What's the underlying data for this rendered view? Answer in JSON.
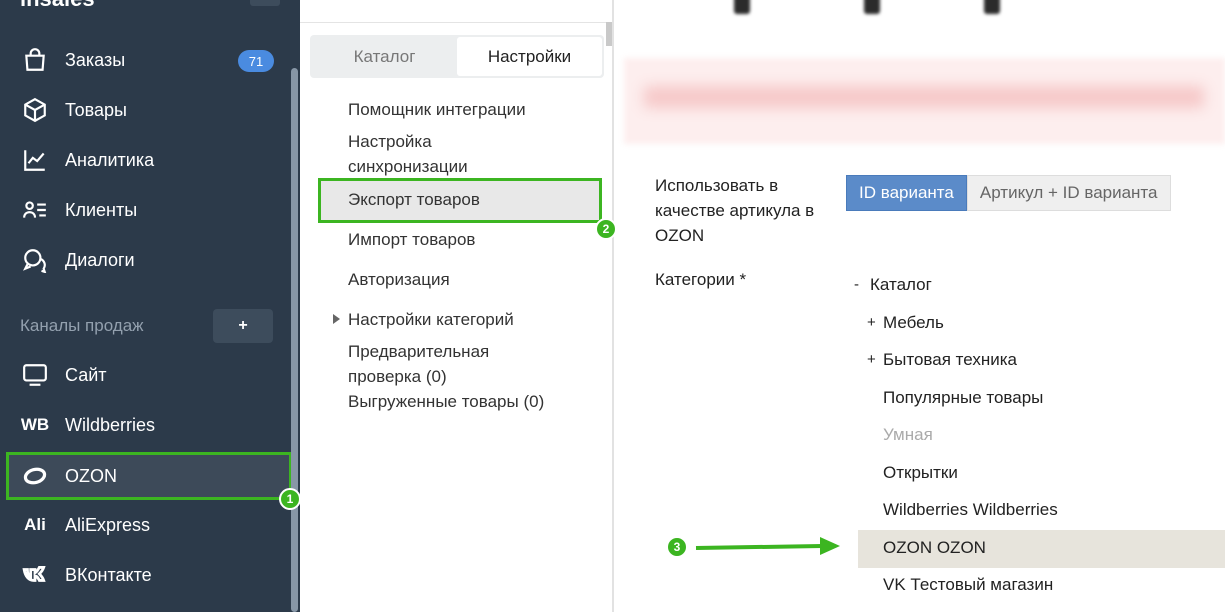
{
  "sidebar": {
    "top_title": "insales",
    "items": [
      {
        "label": "Заказы",
        "icon": "shopping-bag-icon",
        "badge": "71"
      },
      {
        "label": "Товары",
        "icon": "box-icon"
      },
      {
        "label": "Аналитика",
        "icon": "chart-line-icon"
      },
      {
        "label": "Клиенты",
        "icon": "users-list-icon"
      },
      {
        "label": "Диалоги",
        "icon": "chat-bubbles-icon"
      }
    ],
    "section_label": "Каналы продаж",
    "section_add": "+",
    "channels": [
      {
        "label": "Сайт",
        "icon": "monitor-icon"
      },
      {
        "label": "Wildberries",
        "icon_text": "WB"
      },
      {
        "label": "OZON",
        "icon": "ozon-logo-icon"
      },
      {
        "label": "AliExpress",
        "icon_text": "Ali"
      },
      {
        "label": "ВКонтакте",
        "icon": "vk-logo-icon"
      }
    ]
  },
  "markers": {
    "m1": "1",
    "m2": "2",
    "m3": "3"
  },
  "middle": {
    "tabs": [
      {
        "label": "Каталог",
        "active": false
      },
      {
        "label": "Настройки",
        "active": true
      }
    ],
    "menu": [
      "Помощник интеграции",
      "Настройка синхронизации",
      "Экспорт товаров",
      "Импорт товаров",
      "Авторизация",
      "Настройки категорий",
      "Предварительная проверка (0)",
      "Выгруженные товары (0)"
    ],
    "selected": "Экспорт товаров"
  },
  "content": {
    "article_label": "Использовать в качестве артикула в OZON",
    "article_options": [
      {
        "label": "ID варианта",
        "selected": true
      },
      {
        "label": "Артикул + ID варианта",
        "selected": false
      }
    ],
    "categories_label": "Категории *",
    "tree": [
      {
        "sign": "-",
        "label": "Каталог",
        "level": 0
      },
      {
        "sign": "+",
        "label": "Мебель",
        "level": 1
      },
      {
        "sign": "+",
        "label": "Бытовая техника",
        "level": 1
      },
      {
        "sign": "",
        "label": "Популярные товары",
        "level": 1
      },
      {
        "sign": "",
        "label": "Умная",
        "level": 1,
        "muted": true
      },
      {
        "sign": "",
        "label": "Открытки",
        "level": 1
      },
      {
        "sign": "",
        "label": "Wildberries Wildberries",
        "level": 1
      },
      {
        "sign": "",
        "label": "OZON OZON",
        "level": 1,
        "highlighted": true
      },
      {
        "sign": "",
        "label": "VK Тестовый магазин",
        "level": 1
      }
    ]
  },
  "colors": {
    "sidebar_bg": "#2c3a4a",
    "highlight_green": "#3cb521",
    "badge_blue": "#4a8be0",
    "segment_active": "#5b8bc9"
  }
}
